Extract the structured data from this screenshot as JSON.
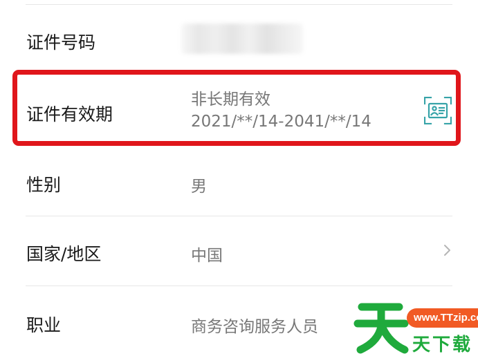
{
  "form": {
    "id_number": {
      "label": "证件号码",
      "value_masked": true
    },
    "id_validity": {
      "label": "证件有效期",
      "value_line1": "非长期有效",
      "value_line2": "2021/**/14-2041/**/14",
      "icon": "id-card-scan-icon"
    },
    "gender": {
      "label": "性别",
      "value": "男"
    },
    "country_region": {
      "label": "国家/地区",
      "value": "中国",
      "icon": "chevron-right-icon"
    },
    "occupation": {
      "label": "职业",
      "value": "商务咨询服务人员"
    }
  },
  "watermark": {
    "url": "www.TTzip.com",
    "text": "天下载",
    "logo_char": "天"
  },
  "colors": {
    "highlight_border": "#e0161b",
    "icon_teal": "#36a3a8",
    "label_text": "#1a1a1a",
    "value_text": "#777777",
    "watermark_green": "#1faa3c",
    "watermark_orange": "#f15a24"
  }
}
